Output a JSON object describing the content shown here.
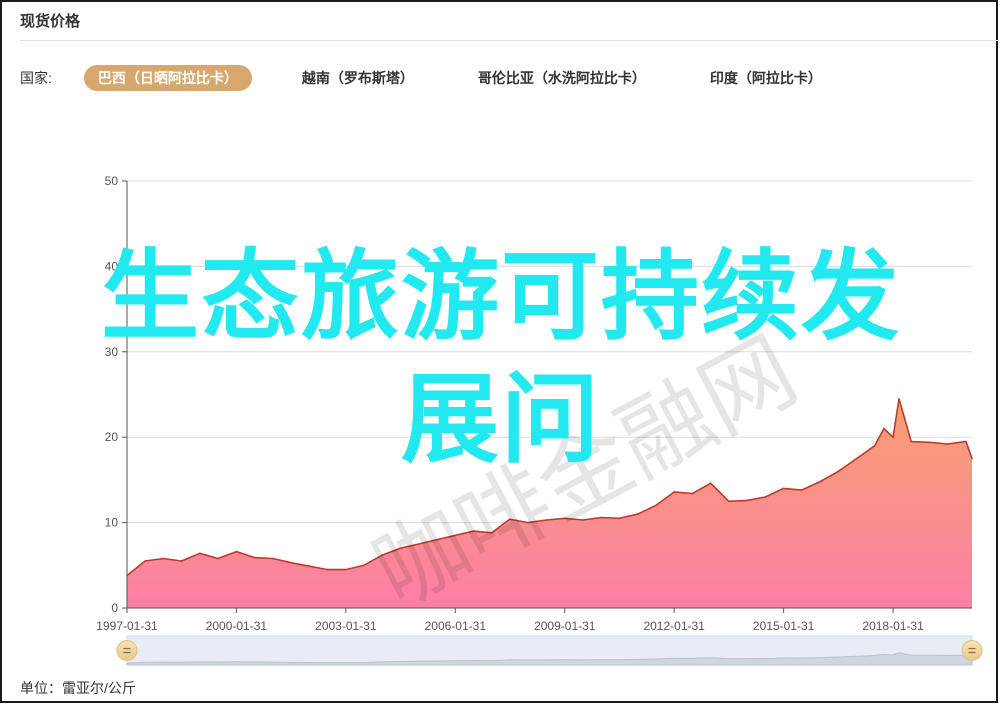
{
  "panel": {
    "title": "现货价格"
  },
  "filters": {
    "label": "国家:",
    "tabs": [
      {
        "label": "巴西（日晒阿拉比卡）",
        "active": true
      },
      {
        "label": "越南（罗布斯塔）",
        "active": false
      },
      {
        "label": "哥伦比亚（水洗阿拉比卡）",
        "active": false
      },
      {
        "label": "印度（阿拉比卡）",
        "active": false
      }
    ]
  },
  "overlay": {
    "line1": "生态旅游可持续发",
    "line2": "展问"
  },
  "watermark": "咖啡金融网",
  "unit": "单位：雷亚尔/公斤",
  "colors": {
    "accent": "#d7a86e",
    "line": "#c0392b",
    "area_top": "#f6a070",
    "area_bottom": "#fc7fa6",
    "overlay": "#22e9f0"
  },
  "chart_data": {
    "type": "area",
    "ylim": [
      0,
      50
    ],
    "yticks": [
      0,
      10,
      20,
      30,
      40,
      50
    ],
    "xlim": [
      "1997-01-31",
      "2020-03-31"
    ],
    "xticks": [
      "1997-01-31",
      "2000-01-31",
      "2003-01-31",
      "2006-01-31",
      "2009-01-31",
      "2012-01-31",
      "2015-01-31",
      "2018-01-31"
    ],
    "grid": true,
    "series": [
      {
        "x": [
          "1997-01-31",
          "1997-07-31",
          "1998-01-31",
          "1998-07-31",
          "1999-01-31",
          "1999-07-31",
          "2000-01-31",
          "2000-07-31",
          "2001-01-31",
          "2001-07-31",
          "2002-01-31",
          "2002-07-31",
          "2003-01-31",
          "2003-07-31",
          "2004-01-31",
          "2004-07-31",
          "2005-01-31",
          "2005-07-31",
          "2006-01-31",
          "2006-07-31",
          "2007-01-31",
          "2007-07-31",
          "2008-01-31",
          "2008-07-31",
          "2009-01-31",
          "2009-07-31",
          "2010-01-31",
          "2010-07-31",
          "2011-01-31",
          "2011-07-31",
          "2012-01-31",
          "2012-07-31",
          "2013-01-31",
          "2013-07-31",
          "2014-01-31",
          "2014-07-31",
          "2015-01-31",
          "2015-07-31",
          "2016-01-31",
          "2016-07-31",
          "2017-01-31",
          "2017-07-31",
          "2017-10-31",
          "2018-01-31",
          "2018-03-31",
          "2018-07-31",
          "2019-01-31",
          "2019-07-31",
          "2020-01-31",
          "2020-03-31"
        ],
        "values": [
          3.8,
          5.5,
          5.8,
          5.5,
          6.4,
          5.8,
          6.6,
          5.9,
          5.8,
          5.3,
          4.9,
          4.5,
          4.5,
          5.0,
          6.2,
          7.0,
          7.5,
          8.0,
          8.5,
          9.0,
          8.8,
          10.4,
          10.0,
          10.3,
          10.5,
          10.3,
          10.6,
          10.5,
          11.0,
          12.0,
          13.6,
          13.4,
          14.6,
          12.5,
          12.6,
          13.0,
          14.0,
          13.8,
          14.8,
          16.0,
          17.5,
          19.0,
          21.0,
          20.0,
          24.5,
          19.5,
          19.4,
          19.2,
          19.5,
          17.5
        ]
      }
    ]
  }
}
